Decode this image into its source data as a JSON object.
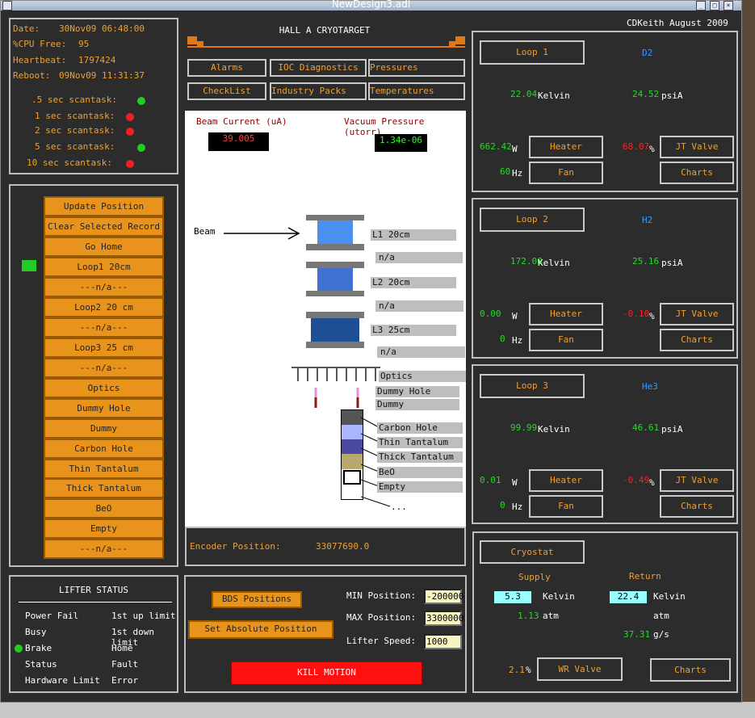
{
  "window": {
    "title": "NewDesign3.adl"
  },
  "header": {
    "title": "HALL A CRYOTARGET",
    "author": "CDKeith August 2009"
  },
  "status": {
    "date_label": "Date:",
    "date": "30Nov09 06:48:00",
    "cpu_label": "%CPU Free:",
    "cpu": "95",
    "heartbeat_label": "Heartbeat:",
    "heartbeat": "1797424",
    "reboot_label": "Reboot:",
    "reboot": "09Nov09 11:31:37",
    "scantasks": [
      {
        "label": ".5 sec scantask:",
        "state": "green"
      },
      {
        "label": "1 sec scantask:",
        "state": "red"
      },
      {
        "label": "2 sec scantask:",
        "state": "red"
      },
      {
        "label": "5 sec scantask:",
        "state": "green"
      },
      {
        "label": "10 sec scantask:",
        "state": "red"
      }
    ]
  },
  "positions": [
    "Update Position",
    "Clear Selected Record",
    "Go Home",
    "Loop1 20cm",
    "---n/a---",
    "Loop2 20 cm",
    "---n/a---",
    "Loop3 25 cm",
    "---n/a---",
    "Optics",
    "Dummy Hole",
    "Dummy",
    "Carbon Hole",
    "Thin Tantalum",
    "Thick Tantalum",
    "BeO",
    "Empty",
    "---n/a---"
  ],
  "nav": {
    "alarms": "Alarms",
    "ioc": "IOC Diagnostics",
    "pressures": "Pressures",
    "checklist": "CheckList",
    "industry": "Industry Packs",
    "temperatures": "Temperatures"
  },
  "target": {
    "beam_current_label": "Beam Current (uA)",
    "beam_current": "39.005",
    "vacuum_label": "Vacuum Pressure (utorr)",
    "vacuum": "1.34e-06",
    "beam_label": "Beam",
    "labels": [
      "L1 20cm",
      "n/a",
      "L2 20cm",
      "n/a",
      "L3 25cm",
      "n/a",
      "Optics",
      "Dummy Hole",
      "Dummy",
      "Carbon Hole",
      "Thin Tantalum",
      "Thick Tantalum",
      "BeO",
      "Empty"
    ],
    "ellipsis": "..."
  },
  "encoder": {
    "label": "Encoder Position:",
    "value": "33077690.0"
  },
  "lifter": {
    "title": "LIFTER STATUS",
    "left": [
      "Power Fail",
      "Busy",
      "Brake",
      "Status",
      "Hardware Limit"
    ],
    "right": [
      "1st up limit",
      "1st down limit",
      "Home",
      "Fault",
      "Error"
    ]
  },
  "motion": {
    "bds": "BDS Positions",
    "set_abs": "Set Absolute Position",
    "kill": "KILL MOTION",
    "min_label": "MIN Position:",
    "min": "-200000",
    "max_label": "MAX Position:",
    "max": "3300000",
    "speed_label": "Lifter Speed:",
    "speed": "1000"
  },
  "loops": [
    {
      "name": "Loop 1",
      "gas": "D2",
      "temp": "22.04",
      "temp_unit": "Kelvin",
      "press": "24.52",
      "press_unit": "psiA",
      "power": "662.42",
      "power_unit": "W",
      "valve": "68.07",
      "valve_unit": "%",
      "freq": "60",
      "freq_unit": "Hz",
      "heater": "Heater",
      "jt": "JT Valve",
      "fan": "Fan",
      "charts": "Charts"
    },
    {
      "name": "Loop 2",
      "gas": "H2",
      "temp": "172.00",
      "temp_unit": "Kelvin",
      "press": "25.16",
      "press_unit": "psiA",
      "power": "0.00",
      "power_unit": "W",
      "valve": "-0.10",
      "valve_unit": "%",
      "freq": "0",
      "freq_unit": "Hz",
      "heater": "Heater",
      "jt": "JT Valve",
      "fan": "Fan",
      "charts": "Charts"
    },
    {
      "name": "Loop 3",
      "gas": "He3",
      "temp": "99.99",
      "temp_unit": "Kelvin",
      "press": "46.61",
      "press_unit": "psiA",
      "power": "0.01",
      "power_unit": "W",
      "valve": "-0.49",
      "valve_unit": "%",
      "freq": "0",
      "freq_unit": "Hz",
      "heater": "Heater",
      "jt": "JT Valve",
      "fan": "Fan",
      "charts": "Charts"
    }
  ],
  "cryostat": {
    "name": "Cryostat",
    "supply": "Supply",
    "return": "Return",
    "supply_temp": "5.3",
    "return_temp": "22.4",
    "kelvin": "Kelvin",
    "supply_press": "1.13",
    "atm": "atm",
    "flow": "37.31",
    "flow_unit": "g/s",
    "wr": "2.1",
    "wr_unit": "%",
    "wr_valve": "WR Valve",
    "charts": "Charts"
  }
}
